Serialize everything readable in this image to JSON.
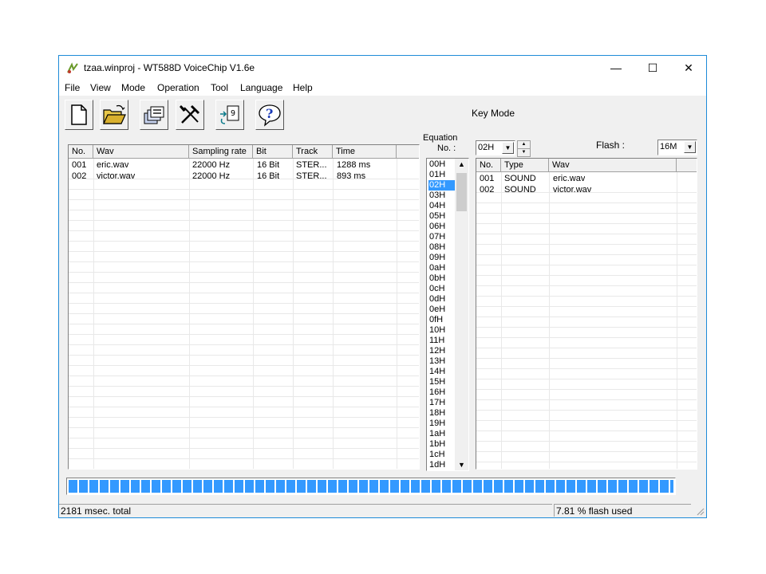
{
  "window": {
    "title": "tzaa.winproj - WT588D VoiceChip V1.6e",
    "controls": {
      "minimize": "—",
      "maximize": "☐",
      "close": "✕"
    }
  },
  "menu": [
    "File",
    "View",
    "Mode",
    "Operation",
    "Tool",
    "Language",
    "Help"
  ],
  "toolbar": {
    "buttons": [
      "new-file-icon",
      "open-folder-icon",
      "save-stack-icon",
      "tools-icon",
      "convert-icon",
      "help-icon"
    ],
    "key_mode_label": "Key Mode"
  },
  "wav_table": {
    "headers": [
      "No.",
      "Wav",
      "Sampling rate",
      "Bit",
      "Track",
      "Time"
    ],
    "rows": [
      [
        "001",
        "eric.wav",
        "22000 Hz",
        "16 Bit",
        "STER...",
        "1288 ms"
      ],
      [
        "002",
        "victor.wav",
        "22000 Hz",
        "16 Bit",
        "STER...",
        "893 ms"
      ]
    ]
  },
  "equation": {
    "label_line1": "Equation",
    "label_line2": "No. :",
    "items": [
      "00H",
      "01H",
      "02H",
      "03H",
      "04H",
      "05H",
      "06H",
      "07H",
      "08H",
      "09H",
      "0aH",
      "0bH",
      "0cH",
      "0dH",
      "0eH",
      "0fH",
      "10H",
      "11H",
      "12H",
      "13H",
      "14H",
      "15H",
      "16H",
      "17H",
      "18H",
      "19H",
      "1aH",
      "1bH",
      "1cH",
      "1dH"
    ],
    "selected": "02H",
    "combo_value": "02H"
  },
  "flash": {
    "label": "Flash :",
    "value": "16M"
  },
  "seq_table": {
    "headers": [
      "No.",
      "Type",
      "Wav"
    ],
    "rows": [
      [
        "001",
        "SOUND",
        "eric.wav"
      ],
      [
        "002",
        "SOUND",
        "victor.wav"
      ]
    ]
  },
  "progress": {
    "fill_fraction": 1.0,
    "color": "#3399ff"
  },
  "status": {
    "left": "2181 msec. total",
    "right": "7.81 % flash used"
  }
}
